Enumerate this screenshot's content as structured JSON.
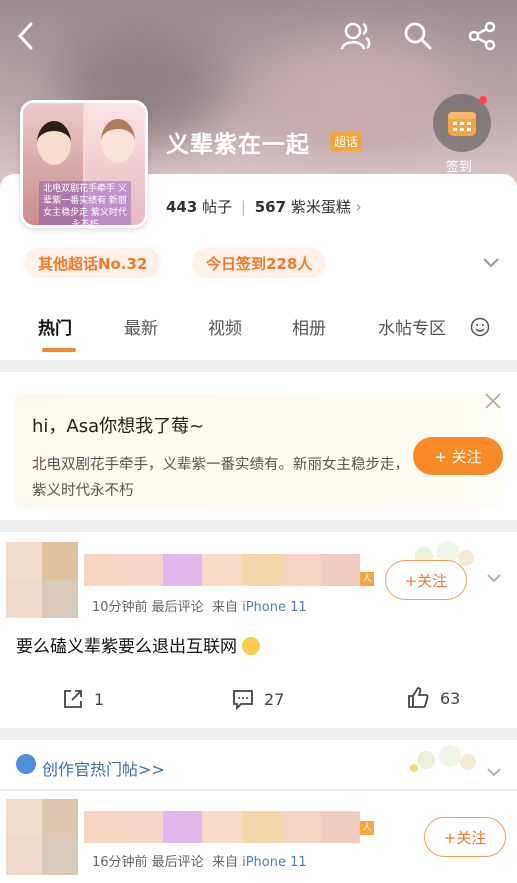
{
  "header": {
    "title": "义辈紫在一起",
    "super_badge": "超话",
    "signin_label": "签到",
    "avatar_caption": "北电双剧花手牵手 义辈紫一番实绩有 新丽女主稳步走 紫义时代永不朽"
  },
  "stats": {
    "posts_count": "443",
    "posts_label": "帖子",
    "fans_count": "567",
    "fans_label": "紫米蛋糕"
  },
  "pills": {
    "rank": "其他超话No.32",
    "checkin": "今日签到228人"
  },
  "tabs": [
    "热门",
    "最新",
    "视频",
    "相册",
    "水帖专区"
  ],
  "greeting": {
    "title": "hi，Asa你想我了莓~",
    "text": "北电双剧花手牵手，义辈紫一番实绩有。新丽女主稳步走，紫义时代永不朽",
    "follow": "+ 关注"
  },
  "post1": {
    "meta_time": "10分钟前 最后评论",
    "meta_from": "来自",
    "device": "iPhone 11",
    "follow": "+关注",
    "text": "要么磕义辈紫要么退出互联网",
    "shares": "1",
    "comments": "27",
    "likes": "63"
  },
  "hot": {
    "label": "创作官热门帖>>"
  },
  "post2": {
    "meta_time": "16分钟前 最后评论",
    "meta_from": "来自",
    "device": "iPhone 11",
    "follow": "+关注"
  },
  "colors": {
    "accent": "#f88b27",
    "link": "#4a7eb8"
  }
}
